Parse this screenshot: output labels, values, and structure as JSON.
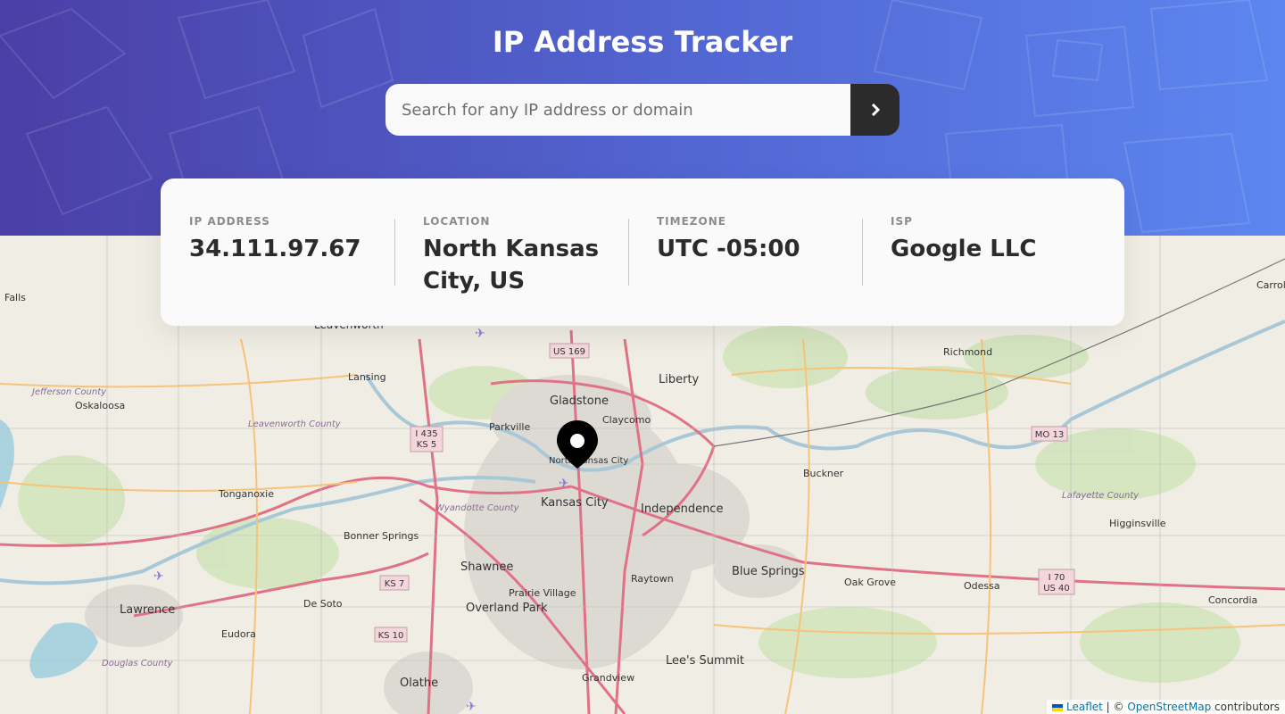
{
  "app": {
    "title": "IP Address Tracker"
  },
  "search": {
    "placeholder": "Search for any IP address or domain",
    "value": "",
    "button_icon": "chevron-right-icon"
  },
  "info": {
    "ip": {
      "label": "IP ADDRESS",
      "value": "34.111.97.67"
    },
    "location": {
      "label": "LOCATION",
      "value": "North Kansas City, US"
    },
    "timezone": {
      "label": "TIMEZONE",
      "value": "UTC -05:00"
    },
    "isp": {
      "label": "ISP",
      "value": "Google LLC"
    }
  },
  "map": {
    "labels": {
      "kansas_city": "Kansas City",
      "gladstone": "Gladstone",
      "liberty": "Liberty",
      "independence": "Independence",
      "shawnee": "Shawnee",
      "overland_park": "Overland Park",
      "lees_summit": "Lee's Summit",
      "blue_springs": "Blue Springs",
      "olathe": "Olathe",
      "lawrence": "Lawrence",
      "leavenworth": "Leavenworth",
      "richmond": "Richmond",
      "oak_grove": "Oak Grove",
      "odessa": "Odessa",
      "concordia": "Concordia",
      "higginsville": "Higginsville",
      "buckner": "Buckner",
      "raytown": "Raytown",
      "prairie_village": "Prairie Village",
      "bonner_springs": "Bonner Springs",
      "tonganoxie": "Tonganoxie",
      "de_soto": "De Soto",
      "eudora": "Eudora",
      "oskaloosa": "Oskaloosa",
      "lansing": "Lansing",
      "claycomo": "Claycomo",
      "parkville": "Parkville",
      "grandview": "Grandview",
      "north_kansas_city": "North Kansas City",
      "carrollton": "Carroll",
      "falls": "Falls",
      "jefferson_county": "Jefferson County",
      "leavenworth_county": "Leavenworth County",
      "wyandotte_county": "Wyandotte County",
      "douglas_county": "Douglas County",
      "lafayette_county": "Lafayette County",
      "us169": "US 169",
      "i435": "I 435",
      "ks5": "KS 5",
      "mo13": "MO 13",
      "ks7": "KS 7",
      "ks10": "KS 10",
      "i70": "I 70",
      "us40": "US 40"
    },
    "marker_icon": "location-pin-icon"
  },
  "attribution": {
    "leaflet": "Leaflet",
    "sep": " | © ",
    "osm": "OpenStreetMap",
    "suffix": " contributors"
  }
}
